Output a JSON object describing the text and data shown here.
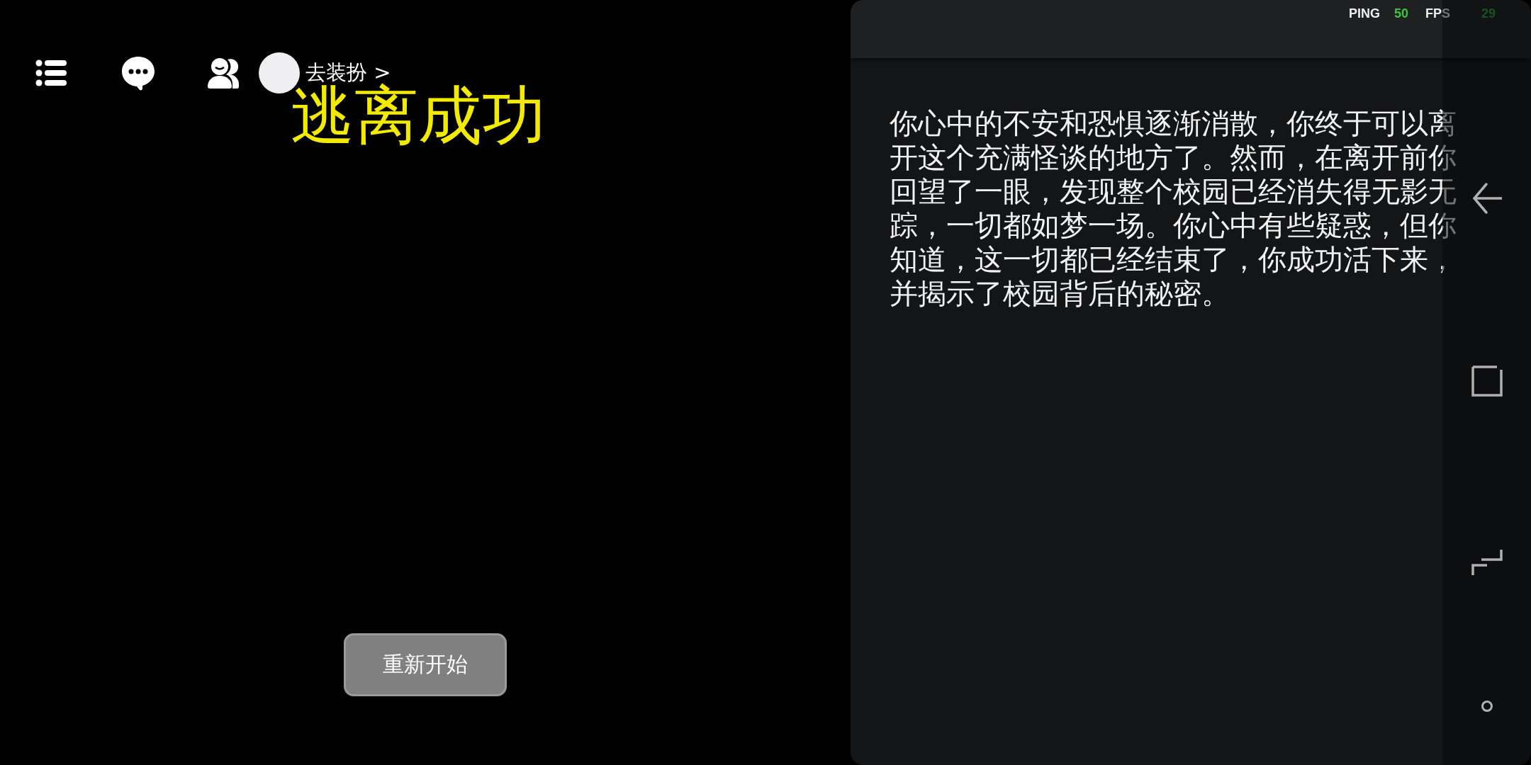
{
  "toolbar": {
    "outfit_link": "去装扮 >"
  },
  "title": "逃离成功",
  "restart_button": "重新开始",
  "status": {
    "ping_label": "PING",
    "ping_value": "50",
    "fps_label": "FPS",
    "fps_value": "29"
  },
  "story_text": "你心中的不安和恐惧逐渐消散，你终于可以离开这个充满怪谈的地方了。然而，在离开前你回望了一眼，发现整个校园已经消失得无影无踪，一切都如梦一场。你心中有些疑惑，但你知道，这一切都已经结束了，你成功活下来，并揭示了校园背后的秘密。"
}
